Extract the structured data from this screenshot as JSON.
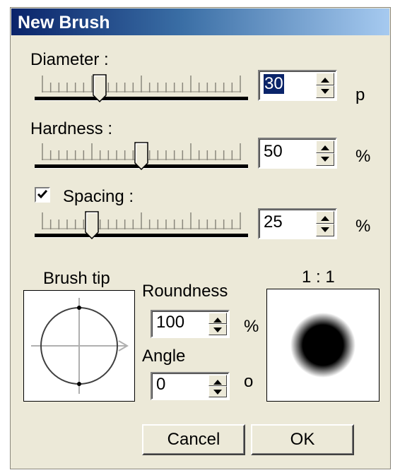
{
  "dialog": {
    "title": "New Brush"
  },
  "diameter": {
    "label": "Diameter :",
    "value": "30",
    "unit": "p",
    "slider_fraction": 0.29
  },
  "hardness": {
    "label": "Hardness :",
    "value": "50",
    "unit": "%",
    "slider_fraction": 0.5
  },
  "spacing": {
    "label": "Spacing :",
    "checked": true,
    "value": "25",
    "unit": "%",
    "slider_fraction": 0.25
  },
  "brush_tip": {
    "label": "Brush tip"
  },
  "roundness": {
    "label": "Roundness",
    "value": "100",
    "unit": "%"
  },
  "angle": {
    "label": "Angle",
    "value": "0",
    "unit": "o"
  },
  "preview": {
    "label": "1 : 1"
  },
  "buttons": {
    "cancel": "Cancel",
    "ok": "OK"
  },
  "colors": {
    "title_start": "#0a246a",
    "title_end": "#a6caf0",
    "selection": "#0a246a",
    "face": "#ece9d8"
  }
}
